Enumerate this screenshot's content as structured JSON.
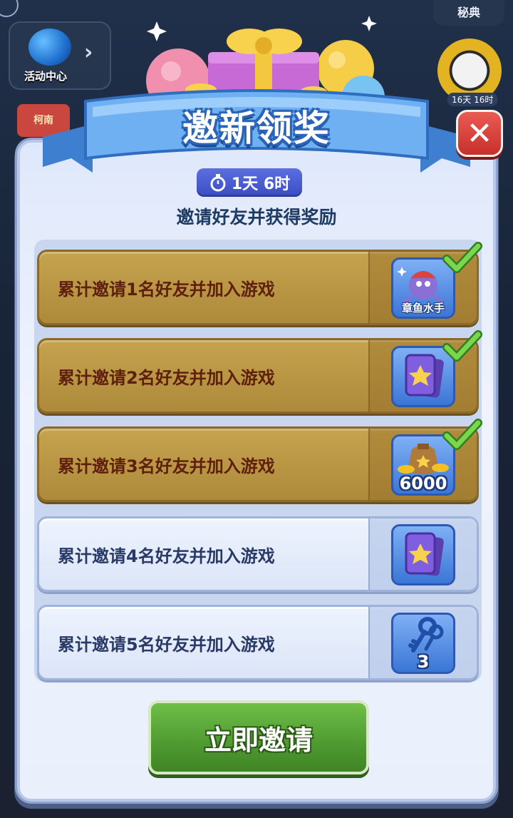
{
  "background": {
    "activity_center_label": "活动中心",
    "secret_label": "秘典",
    "ball_timer": "16天 16时",
    "book_label": "柯南"
  },
  "popup": {
    "title": "邀新领奖",
    "timer": "1天 6时",
    "subtitle": "邀请好友并获得奖励",
    "close_icon": "close-icon"
  },
  "tasks": [
    {
      "label": "累计邀请1名好友并加入游戏",
      "status": "done",
      "reward_name": "章鱼水手",
      "reward_icon": "octopus-sailor-icon"
    },
    {
      "label": "累计邀请2名好友并加入游戏",
      "status": "done",
      "reward_icon": "purple-star-card-icon"
    },
    {
      "label": "累计邀请3名好友并加入游戏",
      "status": "done",
      "reward_amount": "6000",
      "reward_icon": "coin-bag-icon"
    },
    {
      "label": "累计邀请4名好友并加入游戏",
      "status": "todo",
      "reward_icon": "purple-star-card-icon"
    },
    {
      "label": "累计邀请5名好友并加入游戏",
      "status": "todo",
      "reward_amount": "3",
      "reward_icon": "blue-key-icon"
    }
  ],
  "invite_button": "立即邀请",
  "colors": {
    "done_row": "#c6a34e",
    "todo_row": "#eef3fd",
    "title_blue": "#2a64b8",
    "invite_green": "#4e9a30",
    "close_red": "#c7302b"
  }
}
